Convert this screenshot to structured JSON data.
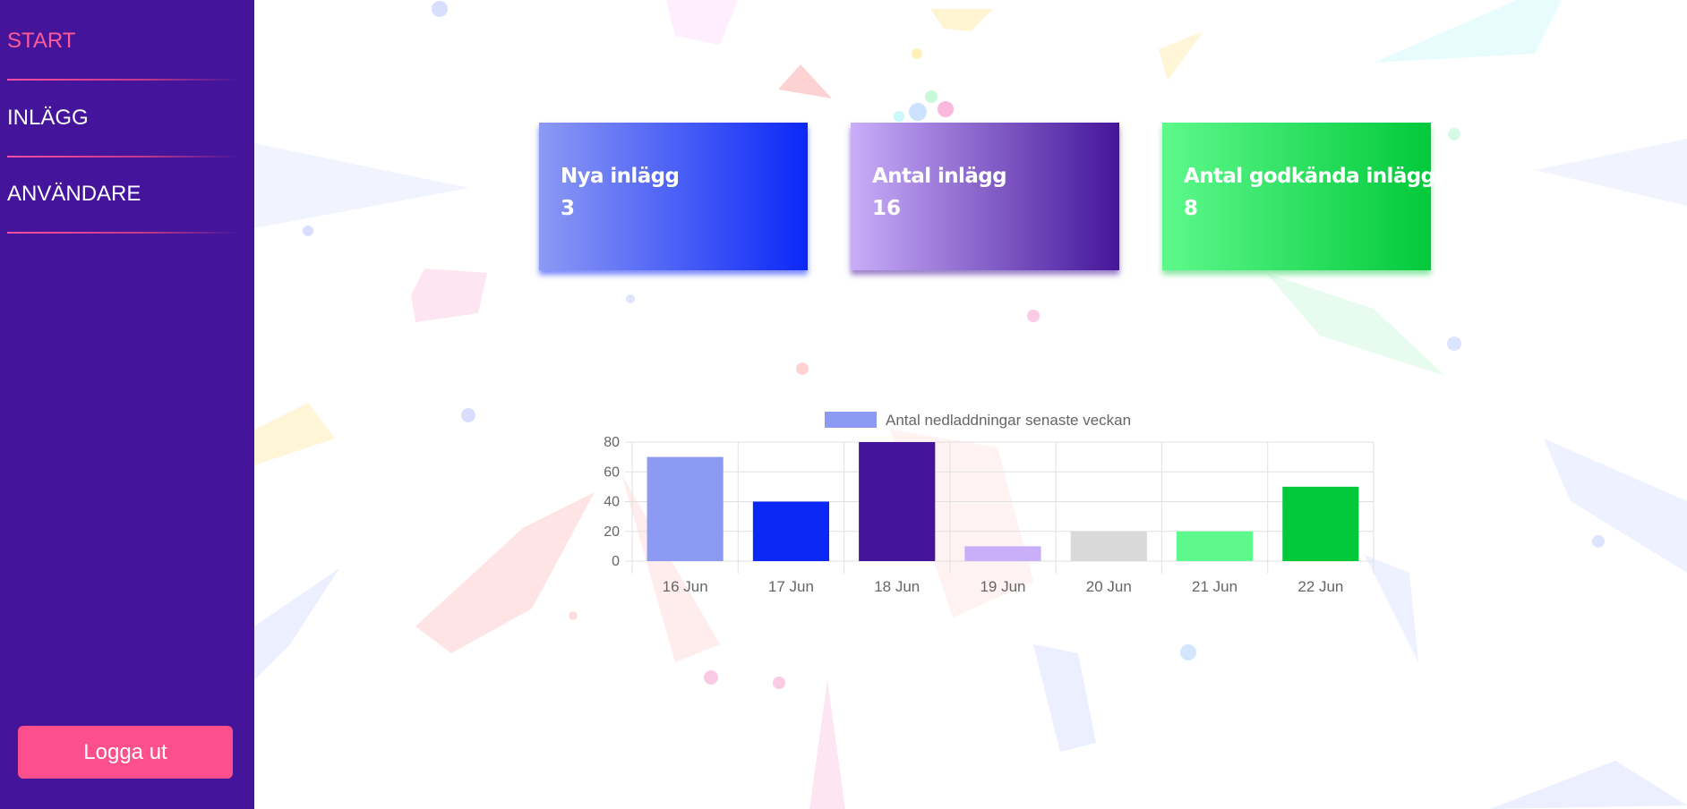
{
  "sidebar": {
    "nav": [
      {
        "label": "START",
        "active": true
      },
      {
        "label": "INLÄGG",
        "active": false
      },
      {
        "label": "ANVÄNDARE",
        "active": false
      }
    ],
    "logout_label": "Logga ut"
  },
  "cards": [
    {
      "title": "Nya inlägg",
      "value": "3"
    },
    {
      "title": "Antal inlägg",
      "value": "16"
    },
    {
      "title": "Antal godkända inlägg",
      "value": "8"
    }
  ],
  "colors": {
    "sidebar_bg": "#44159a",
    "accent_pink": "#fd4f8b",
    "blue": "#0b28f6",
    "purple": "#44159a",
    "green": "#02c93a"
  },
  "chart_data": {
    "type": "bar",
    "legend": "Antal nedladdningar senaste veckan",
    "legend_color": "#8d9af4",
    "legend_position": "top",
    "categories": [
      "16 Jun",
      "17 Jun",
      "18 Jun",
      "19 Jun",
      "20 Jun",
      "21 Jun",
      "22 Jun"
    ],
    "values": [
      70,
      40,
      80,
      10,
      20,
      20,
      50
    ],
    "colors": [
      "#8d9af4",
      "#0b28f6",
      "#44159a",
      "#c9aef9",
      "#d9d9d9",
      "#5ef98c",
      "#02c93a"
    ],
    "ylim": [
      0,
      80
    ],
    "yticks": [
      0,
      20,
      40,
      60,
      80
    ],
    "grid": true
  }
}
